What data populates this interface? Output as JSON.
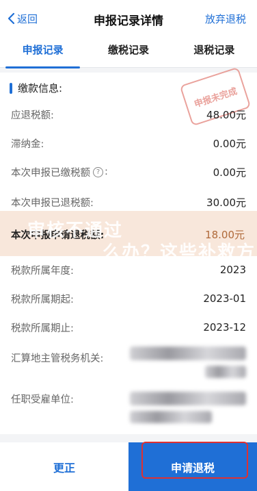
{
  "nav": {
    "back_label": "返回",
    "title": "申报记录详情",
    "abandon_label": "放弃退税"
  },
  "tabs": [
    {
      "label": "申报记录",
      "active": true
    },
    {
      "label": "缴税记录",
      "active": false
    },
    {
      "label": "退税记录",
      "active": false
    }
  ],
  "section": {
    "title": "缴款信息:",
    "stamp_text": "申报未完成"
  },
  "rows": [
    {
      "label": "应退税额:",
      "value": "48.00元"
    },
    {
      "label": "滞纳金:",
      "value": "0.00元"
    },
    {
      "label": "本次申报已缴税额",
      "value": "0.00元",
      "suffix": ":"
    },
    {
      "label": "本次申报已退税额:",
      "value": "30.00元"
    },
    {
      "label": "本次申报申请退税额:",
      "value": "18.00元"
    },
    {
      "label": "税款所属年度:",
      "value": "2023"
    },
    {
      "label": "税款所属期起:",
      "value": "2023-01"
    },
    {
      "label": "税款所属期止:",
      "value": "2023-12"
    },
    {
      "label": "汇算地主管税务机关:",
      "value": ""
    },
    {
      "label": "任职受雇单位:",
      "value": ""
    }
  ],
  "overlay": {
    "line1": "审核不通过",
    "line2": "么办？这些补救方"
  },
  "footer": {
    "fix_label": "更正",
    "refund_label": "申请退税"
  },
  "colors": {
    "accent": "#1f6fd6",
    "stamp": "#e3847c",
    "highlight_box": "#e03030"
  }
}
